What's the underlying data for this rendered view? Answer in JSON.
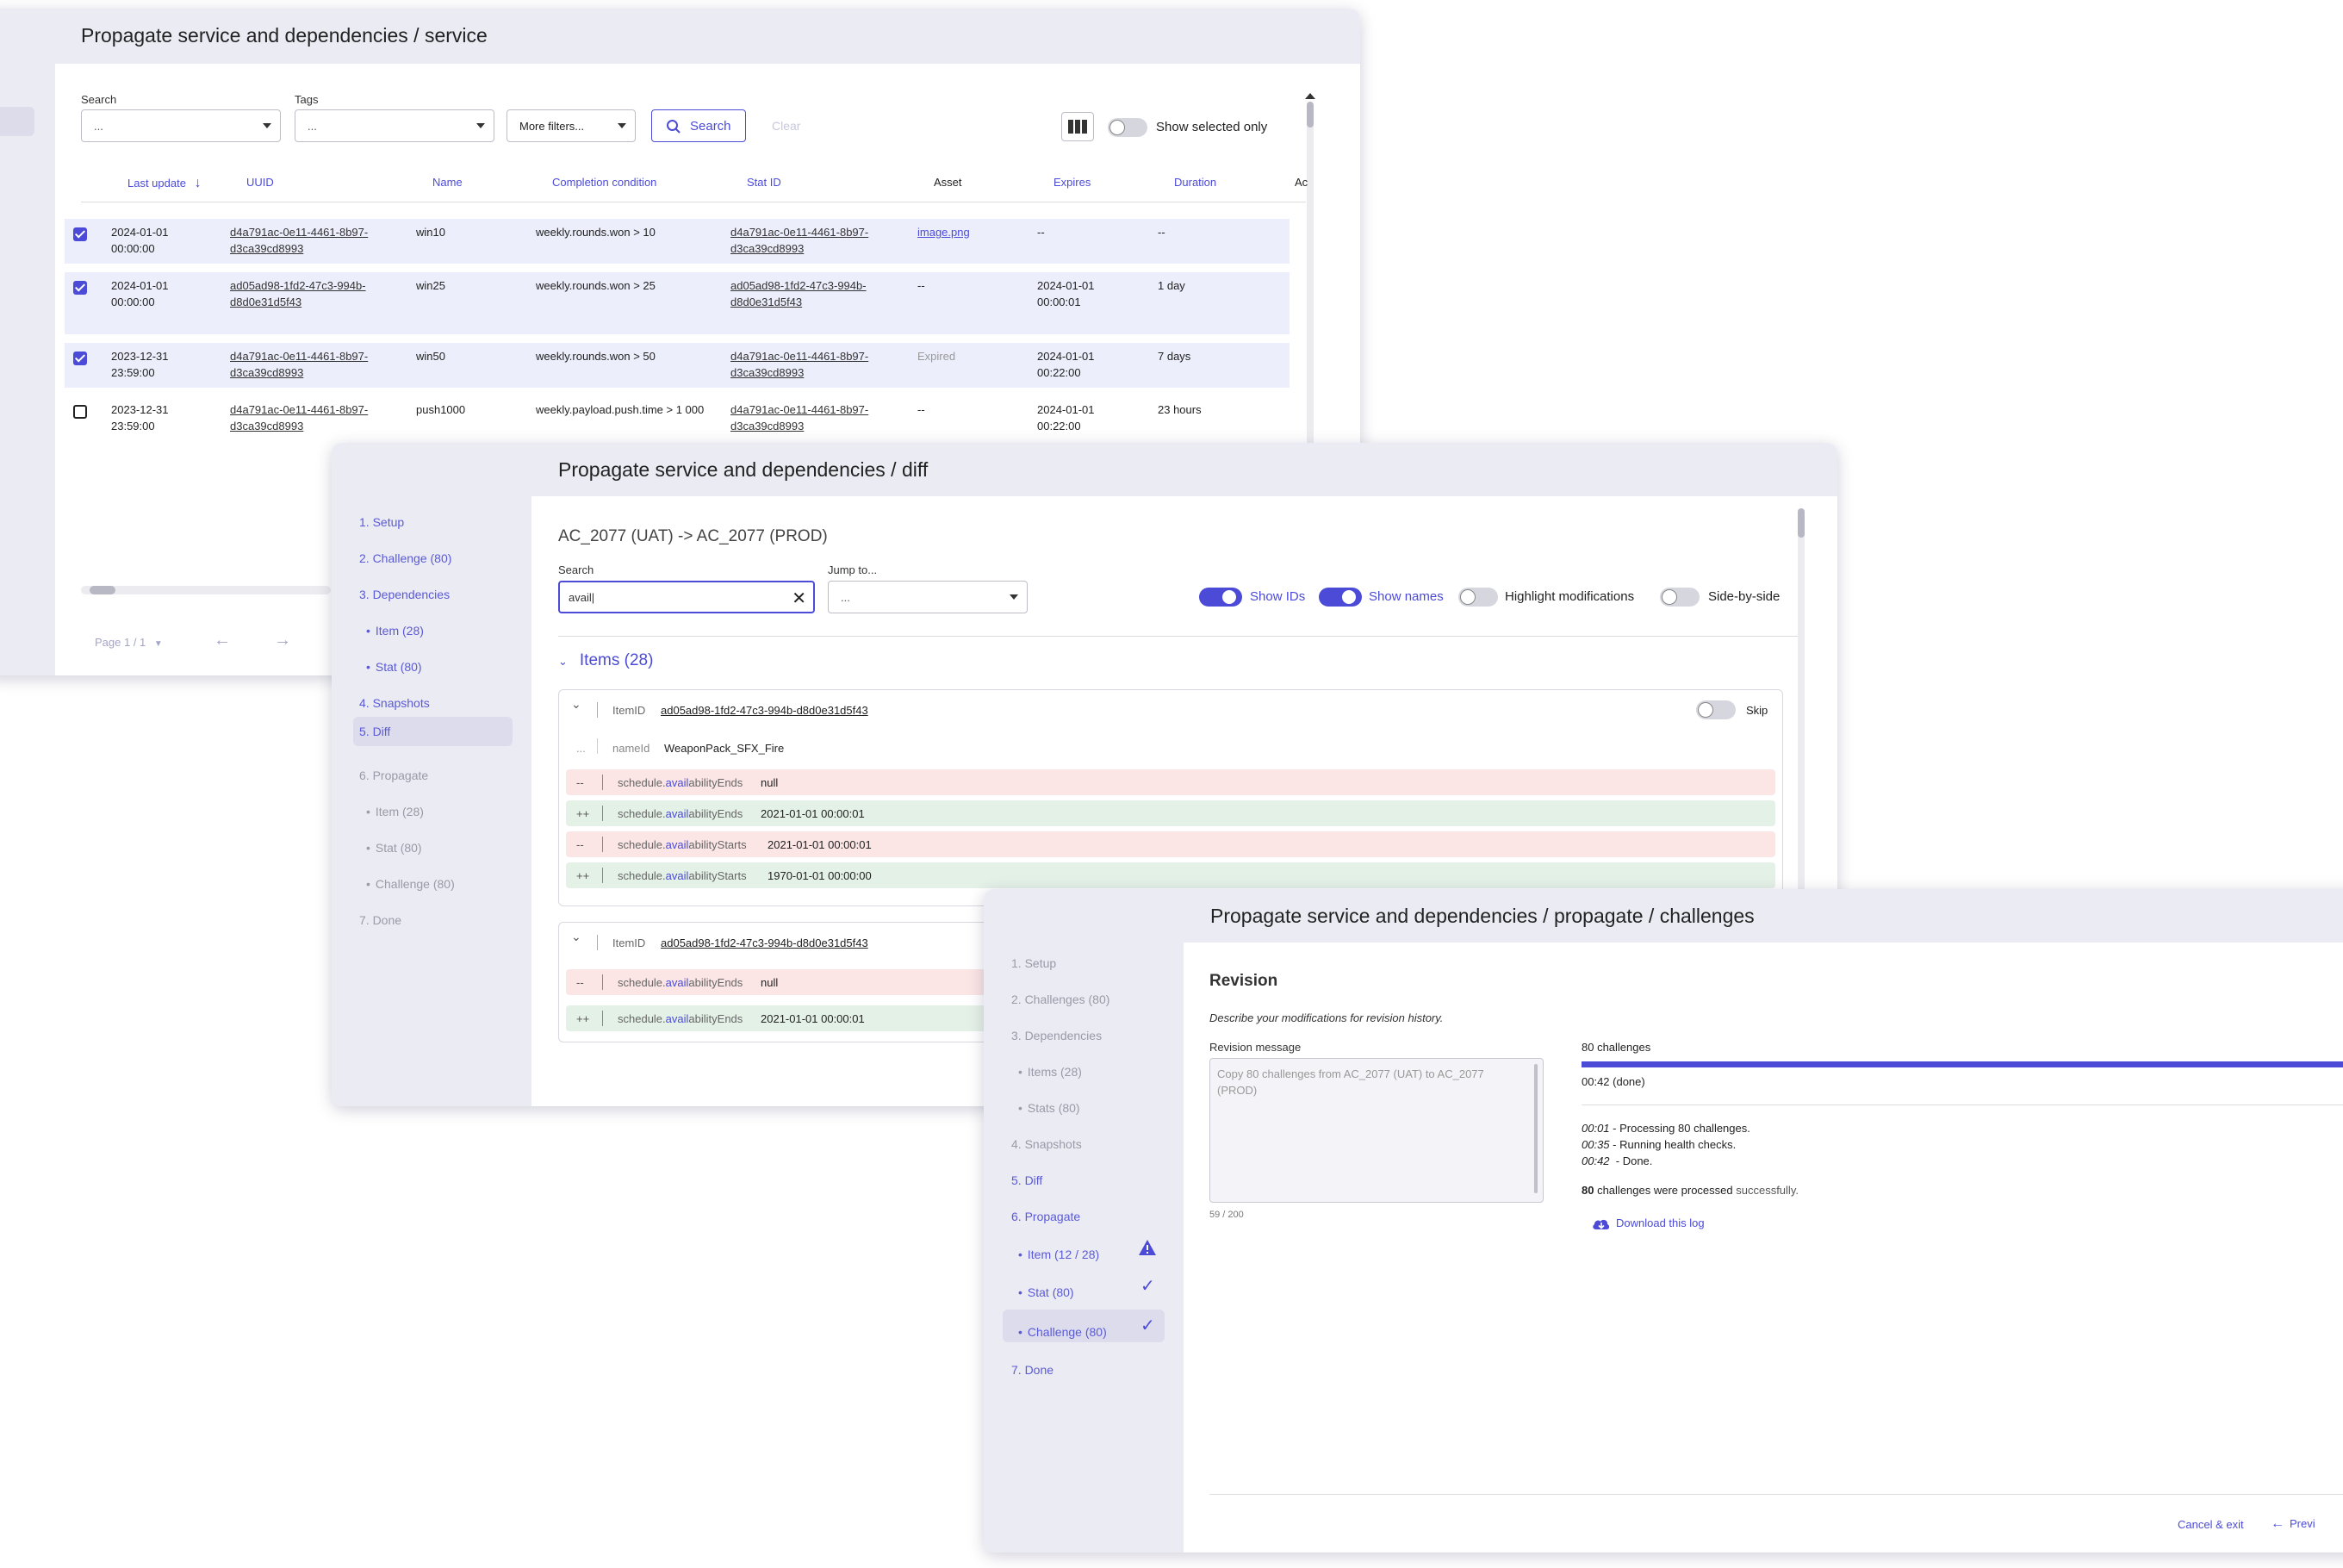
{
  "window1": {
    "title": "Propagate service and dependencies / service",
    "filters": {
      "search_label": "Search",
      "search_value": "...",
      "tags_label": "Tags",
      "tags_value": "...",
      "more_filters": "More filters...",
      "search_button": "Search",
      "clear_button": "Clear",
      "show_selected_only": "Show selected only"
    },
    "columns": [
      "Last update",
      "UUID",
      "Name",
      "Completion condition",
      "Stat ID",
      "Asset",
      "Expires",
      "Duration",
      "Ac"
    ],
    "rows": [
      {
        "selected": true,
        "last_update_1": "2024-01-01",
        "last_update_2": "00:00:00",
        "uuid_1": "d4a791ac-0e11-4461-8b97-",
        "uuid_2": "d3ca39cd8993",
        "name": "win10",
        "condition": "weekly.rounds.won > 10",
        "stat_1": "d4a791ac-0e11-4461-8b97-",
        "stat_2": "d3ca39cd8993",
        "asset": "image.png",
        "expires_1": "--",
        "expires_2": "",
        "duration": "--"
      },
      {
        "selected": true,
        "last_update_1": "2024-01-01",
        "last_update_2": "00:00:00",
        "uuid_1": "ad05ad98-1fd2-47c3-994b-",
        "uuid_2": "d8d0e31d5f43",
        "name": "win25",
        "condition": "weekly.rounds.won > 25",
        "stat_1": "ad05ad98-1fd2-47c3-994b-",
        "stat_2": "d8d0e31d5f43",
        "asset": "--",
        "expires_1": "2024-01-01",
        "expires_2": "00:00:01",
        "duration": "1 day"
      },
      {
        "selected": true,
        "last_update_1": "2023-12-31",
        "last_update_2": "23:59:00",
        "uuid_1": "d4a791ac-0e11-4461-8b97-",
        "uuid_2": "d3ca39cd8993",
        "name": "win50",
        "condition": "weekly.rounds.won > 50",
        "stat_1": "d4a791ac-0e11-4461-8b97-",
        "stat_2": "d3ca39cd8993",
        "asset": "Expired",
        "expires_1": "2024-01-01",
        "expires_2": "00:22:00",
        "duration": "7 days"
      },
      {
        "selected": false,
        "last_update_1": "2023-12-31",
        "last_update_2": "23:59:00",
        "uuid_1": "d4a791ac-0e11-4461-8b97-",
        "uuid_2": "d3ca39cd8993",
        "name": "push1000",
        "condition": "weekly.payload.push.time > 1 000",
        "stat_1": "d4a791ac-0e11-4461-8b97-",
        "stat_2": "d3ca39cd8993",
        "asset": "--",
        "expires_1": "2024-01-01",
        "expires_2": "00:22:00",
        "duration": "23 hours"
      }
    ],
    "pagination": "Page 1 / 1"
  },
  "window2": {
    "title": "Propagate service and dependencies / diff",
    "steps": [
      "1. Setup",
      "2. Challenge (80)",
      "3. Dependencies",
      "Item (28)",
      "Stat (80)",
      "4. Snapshots",
      "5. Diff",
      "6. Propagate",
      "Item (28)",
      "Stat (80)",
      "Challenge (80)",
      "7. Done"
    ],
    "heading": "AC_2077 (UAT) -> AC_2077 (PROD)",
    "search_label": "Search",
    "search_value": "avail|",
    "jump_label": "Jump to...",
    "jump_value": "...",
    "toggles": {
      "show_ids": "Show IDs",
      "show_names": "Show names",
      "highlight": "Highlight modifications",
      "side_by_side": "Side-by-side"
    },
    "section": "Items (28)",
    "card1": {
      "item_label": "ItemID",
      "item_id": "ad05ad98-1fd2-47c3-994b-d8d0e31d5f43",
      "skip": "Skip",
      "context_sign": "...",
      "name_key": "nameId",
      "name_value": "WeaponPack_SFX_Fire",
      "lines": [
        {
          "sign": "--",
          "k1": "schedule.",
          "k2": "avail",
          "k3": "abilityEnds",
          "value": "null"
        },
        {
          "sign": "++",
          "k1": "schedule.",
          "k2": "avail",
          "k3": "abilityEnds",
          "value": "2021-01-01 00:00:01"
        },
        {
          "sign": "--",
          "k1": "schedule.",
          "k2": "avail",
          "k3": "abilityStarts",
          "value": "2021-01-01 00:00:01"
        },
        {
          "sign": "++",
          "k1": "schedule.",
          "k2": "avail",
          "k3": "abilityStarts",
          "value": "1970-01-01 00:00:00"
        }
      ]
    },
    "card2": {
      "item_label": "ItemID",
      "item_id": "ad05ad98-1fd2-47c3-994b-d8d0e31d5f43",
      "lines": [
        {
          "sign": "--",
          "k1": "schedule.",
          "k2": "avail",
          "k3": "abilityEnds",
          "value": "null"
        },
        {
          "sign": "++",
          "k1": "schedule.",
          "k2": "avail",
          "k3": "abilityEnds",
          "value": "2021-01-01 00:00:01"
        }
      ]
    }
  },
  "window3": {
    "title": "Propagate service and dependencies / propagate / challenges",
    "steps": [
      "1. Setup",
      "2. Challenges (80)",
      "3. Dependencies",
      "Items (28)",
      "Stats (80)",
      "4. Snapshots",
      "5. Diff",
      "6. Propagate",
      "Item (12 / 28)",
      "Stat (80)",
      "Challenge (80)",
      "7. Done"
    ],
    "heading": "Revision",
    "description": "Describe your modifications for revision history.",
    "message_label": "Revision message",
    "message_placeholder": "Copy 80 challenges from AC_2077 (UAT) to AC_2077 (PROD)",
    "char_count": "59 / 200",
    "progress_label": "80 challenges",
    "progress_value": 1.0,
    "progress_status": "00:42 (done)",
    "log": [
      {
        "time": "00:01",
        "text": " - Processing 80 challenges."
      },
      {
        "time": "00:35",
        "text": " - Running health checks."
      },
      {
        "time": "00:42",
        "text": "  - Done."
      }
    ],
    "result_count": "80",
    "result_mid": " challenges were processed ",
    "result_end": "successfully.",
    "download": "Download this log",
    "cancel": "Cancel & exit",
    "previous": "Previ"
  },
  "colors": {
    "accent": "#4b4bd8",
    "panel": "#ebebf3",
    "minus": "#fbe5e5",
    "plus": "#e4f1e7"
  }
}
